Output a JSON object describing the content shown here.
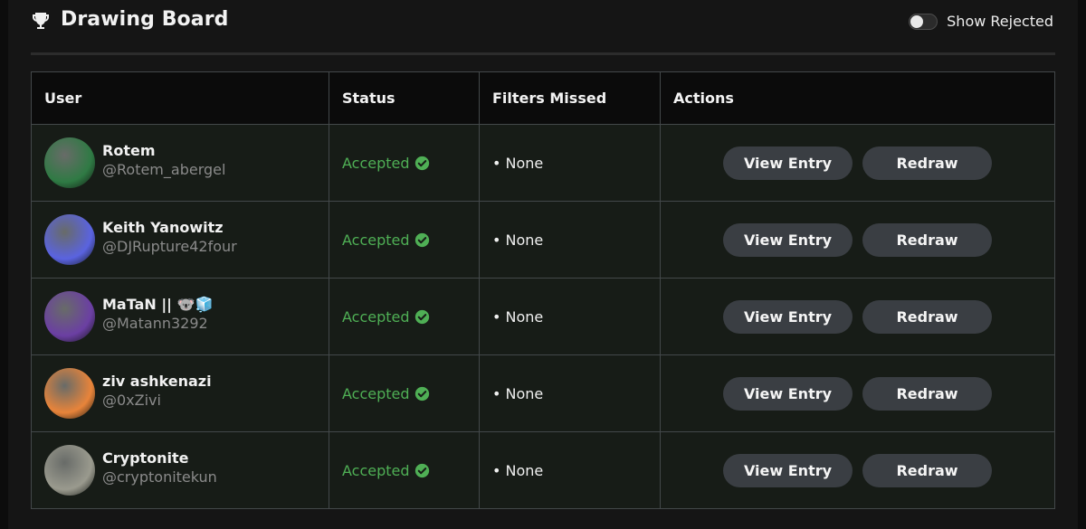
{
  "header": {
    "title": "Drawing Board",
    "toggle_label": "Show Rejected"
  },
  "table": {
    "columns": [
      "User",
      "Status",
      "Filters Missed",
      "Actions"
    ],
    "rows": [
      {
        "name": "Rotem",
        "handle": "@Rotem_abergel",
        "status": "Accepted",
        "filters": "• None",
        "view_label": "View Entry",
        "redraw_label": "Redraw",
        "avatar_color": "#2f7a44"
      },
      {
        "name": "Keith Yanowitz",
        "handle": "@DJRupture42four",
        "status": "Accepted",
        "filters": "• None",
        "view_label": "View Entry",
        "redraw_label": "Redraw",
        "avatar_color": "#5a63e0"
      },
      {
        "name": "MaTaN || 🐨🧊",
        "handle": "@Matann3292",
        "status": "Accepted",
        "filters": "• None",
        "view_label": "View Entry",
        "redraw_label": "Redraw",
        "avatar_color": "#6b3fa3"
      },
      {
        "name": "ziv ashkenazi",
        "handle": "@0xZivi",
        "status": "Accepted",
        "filters": "• None",
        "view_label": "View Entry",
        "redraw_label": "Redraw",
        "avatar_color": "#e8843a"
      },
      {
        "name": "Cryptonite",
        "handle": "@cryptonitekun",
        "status": "Accepted",
        "filters": "• None",
        "view_label": "View Entry",
        "redraw_label": "Redraw",
        "avatar_color": "#9a9a8e"
      }
    ]
  },
  "colors": {
    "accepted": "#4faf55",
    "button_bg": "#3a3e43",
    "row_bg": "#171c17"
  },
  "icons": {
    "header": "trophy-icon",
    "status": "check-circle-icon"
  }
}
